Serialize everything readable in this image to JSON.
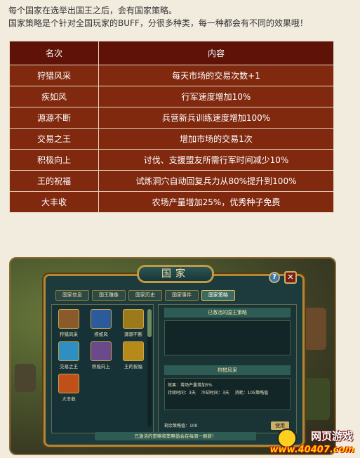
{
  "intro": {
    "line1": "每个国家在选举出国王之后，会有国家策略。",
    "line2": "国家策略是个针对全国玩家的BUFF，分很多种类，每一种都会有不同的效果哦！"
  },
  "table": {
    "headers": [
      "名次",
      "内容"
    ],
    "rows": [
      {
        "name": "狩猎风采",
        "content": "每天市场的交易次数+1"
      },
      {
        "name": "疾如风",
        "content": "行军速度增加10%"
      },
      {
        "name": "源源不断",
        "content": "兵营新兵训练速度增加100%"
      },
      {
        "name": "交易之王",
        "content": "增加市场的交易1次"
      },
      {
        "name": "积极向上",
        "content": "讨伐、支援盟友所需行军时间减少10%"
      },
      {
        "name": "王的祝福",
        "content": "试炼洞穴自动回复兵力从80%提升到100%"
      },
      {
        "name": "大丰收",
        "content": "农场产量增加25%，优秀种子免费"
      }
    ]
  },
  "game": {
    "window_title": "国家",
    "help": "?",
    "close": "✕",
    "tabs": [
      "国家信息",
      "国王雕像",
      "国家历史",
      "国家事件",
      "国家策略"
    ],
    "active_tab": 4,
    "policies": [
      "狩猎风采",
      "疾如风",
      "源源不断",
      "交易之王",
      "积极向上",
      "王的祝福",
      "大丰收"
    ],
    "activated_header": "已激活的国王策略",
    "selected_policy": "狩猎风采",
    "effect": "效果：增场产量增加5%",
    "duration": "持续时间：3天",
    "cooldown": "冷却时间：3天",
    "cost": "消耗：105策略值",
    "remaining": "剩余策略值：100",
    "use_label": "使用",
    "footer": "已激活的策略和策略值会在每周一刷新！"
  },
  "logo": {
    "title": "网页游戏",
    "url": "www.40407.com"
  },
  "colors": {
    "header_bg": "#5e1208",
    "row_bg": "#81290f",
    "panel_bg": "#1d3a3d",
    "gold": "#c09a45"
  }
}
